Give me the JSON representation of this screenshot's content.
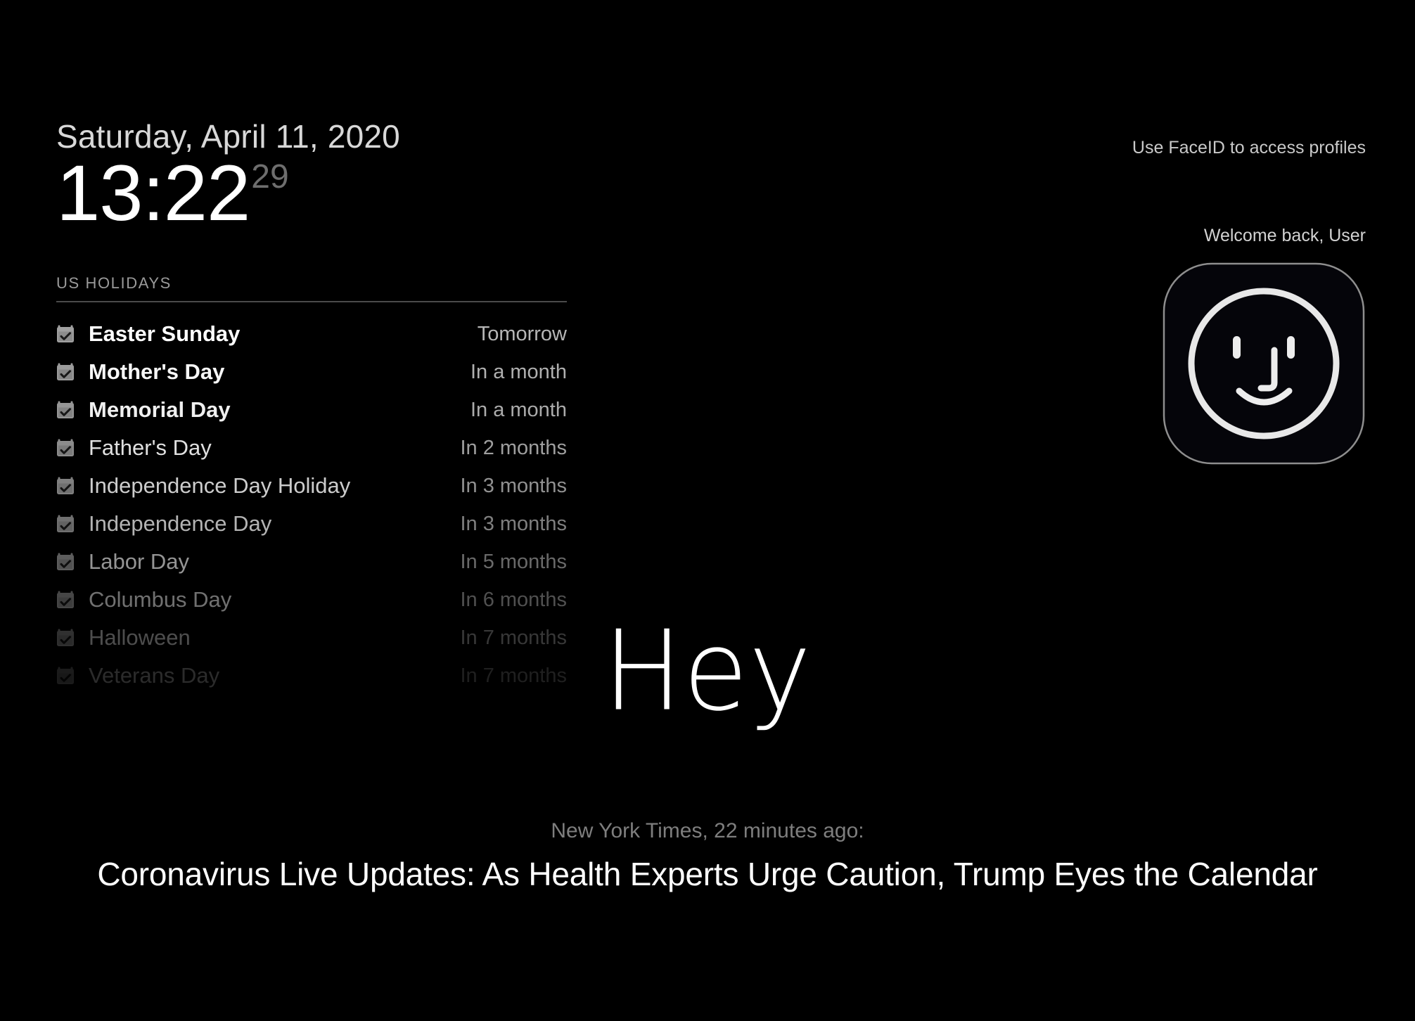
{
  "colors": {
    "background": "#000000",
    "primary_text": "#ffffff",
    "muted_text": "#b6b6b6",
    "dim_text": "#7e7e7e",
    "divider": "#4b4b4b",
    "seconds": "#6e6e6e",
    "icon_gray": "#a0a0a0"
  },
  "clock": {
    "date": "Saturday, April 11, 2020",
    "time": "13:22",
    "seconds": "29"
  },
  "holidays": {
    "section_title": "US HOLIDAYS",
    "icon": "calendar-check-icon",
    "items": [
      {
        "name": "Easter Sunday",
        "when": "Tomorrow"
      },
      {
        "name": "Mother's Day",
        "when": "In a month"
      },
      {
        "name": "Memorial Day",
        "when": "In a month"
      },
      {
        "name": "Father's Day",
        "when": "In 2 months"
      },
      {
        "name": "Independence Day Holiday",
        "when": "In 3 months"
      },
      {
        "name": "Independence Day",
        "when": "In 3 months"
      },
      {
        "name": "Labor Day",
        "when": "In 5 months"
      },
      {
        "name": "Columbus Day",
        "when": "In 6 months"
      },
      {
        "name": "Halloween",
        "when": "In 7 months"
      },
      {
        "name": "Veterans Day",
        "when": "In 7 months"
      }
    ]
  },
  "profile": {
    "faceid_hint": "Use FaceID to access profiles",
    "welcome": "Welcome back, User",
    "icon": "faceid-face-icon"
  },
  "greeting": {
    "text": "Hey"
  },
  "news": {
    "source": "New York Times, 22 minutes ago:",
    "headline": "Coronavirus Live Updates: As Health Experts Urge Caution, Trump Eyes the Calendar"
  }
}
